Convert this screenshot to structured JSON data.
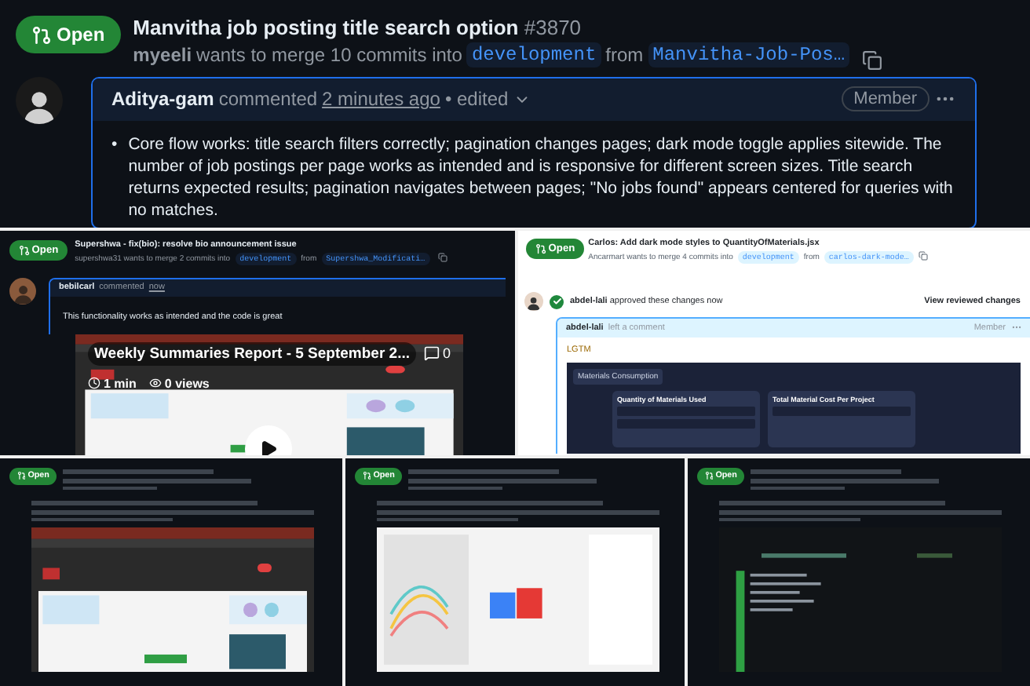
{
  "main_pr": {
    "status": "Open",
    "title": "Manvitha job posting title search option",
    "number": "#3870",
    "author": "myeeli",
    "merge_text": "wants to merge 10 commits into",
    "base_branch": "development",
    "from_text": "from",
    "head_branch": "Manvitha-Job-Pos…",
    "comment": {
      "marker": "•",
      "author": "Aditya-gam",
      "action": "commented",
      "time": "2 minutes ago",
      "edited": "• edited",
      "role": "Member",
      "bullets": [
        "Core flow works: title search filters correctly; pagination changes pages; dark mode toggle applies sitewide. The number of job postings per page works as intended and is responsive for different screen sizes. Title search returns expected results; pagination navigates between pages; \"No jobs found\" appears centered for queries with no matches."
      ]
    }
  },
  "video_tile": {
    "status": "Open",
    "title": "Supershwa - fix(bio): resolve bio announcement issue",
    "author": "supershwa31",
    "merge_text": "wants to merge 2 commits into",
    "base_branch": "development",
    "from_text": "from",
    "head_branch": "Supershwa_Modificati…",
    "commenter": "bebilcarl",
    "action": "commented",
    "time": "now",
    "body": "This functionality works as intended and the code is great",
    "video": {
      "title": "Weekly Summaries Report - 5 September 2...",
      "comments": "0",
      "duration": "1 min",
      "views": "0 views"
    }
  },
  "review_tile": {
    "status": "Open",
    "title": "Carlos: Add dark mode styles to QuantityOfMaterials.jsx",
    "author": "Ancarmart",
    "merge_text": "wants to merge 4 commits into",
    "base_branch": "development",
    "from_text": "from",
    "head_branch": "carlos-dark-mode…",
    "reviewer": "abdel-lali",
    "review_text": "approved these changes now",
    "view_link": "View reviewed changes",
    "comment_author": "abdel-lali",
    "comment_action": "left a comment",
    "role": "Member",
    "body": "LGTM",
    "dashboard": {
      "tab": "Materials Consumption",
      "card_1": "Quantity of Materials Used",
      "card_2": "Total Material Cost Per Project"
    }
  },
  "small_tiles": [
    {
      "status": "Open",
      "kind": "webpage"
    },
    {
      "status": "Open",
      "kind": "chart"
    },
    {
      "status": "Open",
      "kind": "code"
    }
  ]
}
